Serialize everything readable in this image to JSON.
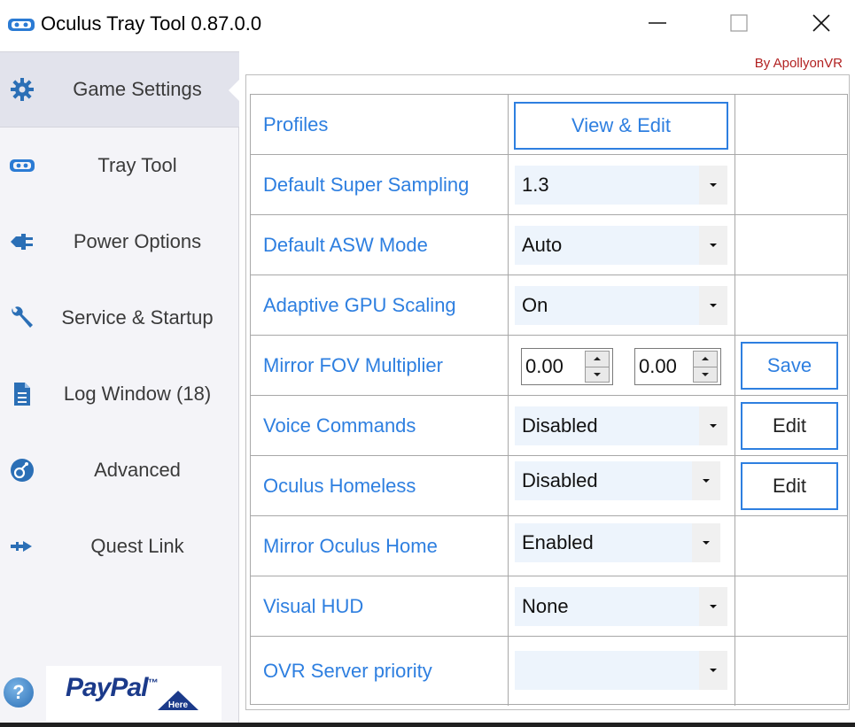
{
  "window": {
    "title": "Oculus Tray Tool 0.87.0.0",
    "byline": "By ApollyonVR"
  },
  "colors": {
    "accent": "#2e7fe0",
    "byline": "#b22222",
    "sidebar_bg": "#f4f4f8",
    "sidebar_active": "#e2e3ec"
  },
  "sidebar": {
    "items": [
      {
        "label": "Game Settings",
        "icon": "gear-icon",
        "active": true
      },
      {
        "label": "Tray Tool",
        "icon": "vr-headset-icon"
      },
      {
        "label": "Power Options",
        "icon": "plug-icon"
      },
      {
        "label": "Service & Startup",
        "icon": "wrench-icon"
      },
      {
        "label": "Log Window (18)",
        "icon": "document-icon"
      },
      {
        "label": "Advanced",
        "icon": "advanced-icon"
      },
      {
        "label": "Quest Link",
        "icon": "link-arrow-icon"
      }
    ],
    "help": "?",
    "paypal": {
      "text": "PayPal",
      "tm": "™",
      "badge": "Here"
    }
  },
  "settings": {
    "profiles": {
      "label": "Profiles",
      "button": "View & Edit"
    },
    "super_sampling": {
      "label": "Default Super Sampling",
      "value": "1.3"
    },
    "asw_mode": {
      "label": "Default ASW Mode",
      "value": "Auto"
    },
    "gpu_scaling": {
      "label": "Adaptive GPU Scaling",
      "value": "On"
    },
    "mirror_fov": {
      "label": "Mirror FOV Multiplier",
      "value1": "0.00",
      "value2": "0.00",
      "button": "Save"
    },
    "voice_commands": {
      "label": "Voice Commands",
      "value": "Disabled",
      "button": "Edit"
    },
    "homeless": {
      "label": "Oculus Homeless",
      "value": "Disabled",
      "button": "Edit"
    },
    "mirror_home": {
      "label": "Mirror Oculus Home",
      "value": "Enabled"
    },
    "visual_hud": {
      "label": "Visual HUD",
      "value": "None"
    },
    "ovr_priority": {
      "label": "OVR Server priority",
      "value": ""
    }
  }
}
